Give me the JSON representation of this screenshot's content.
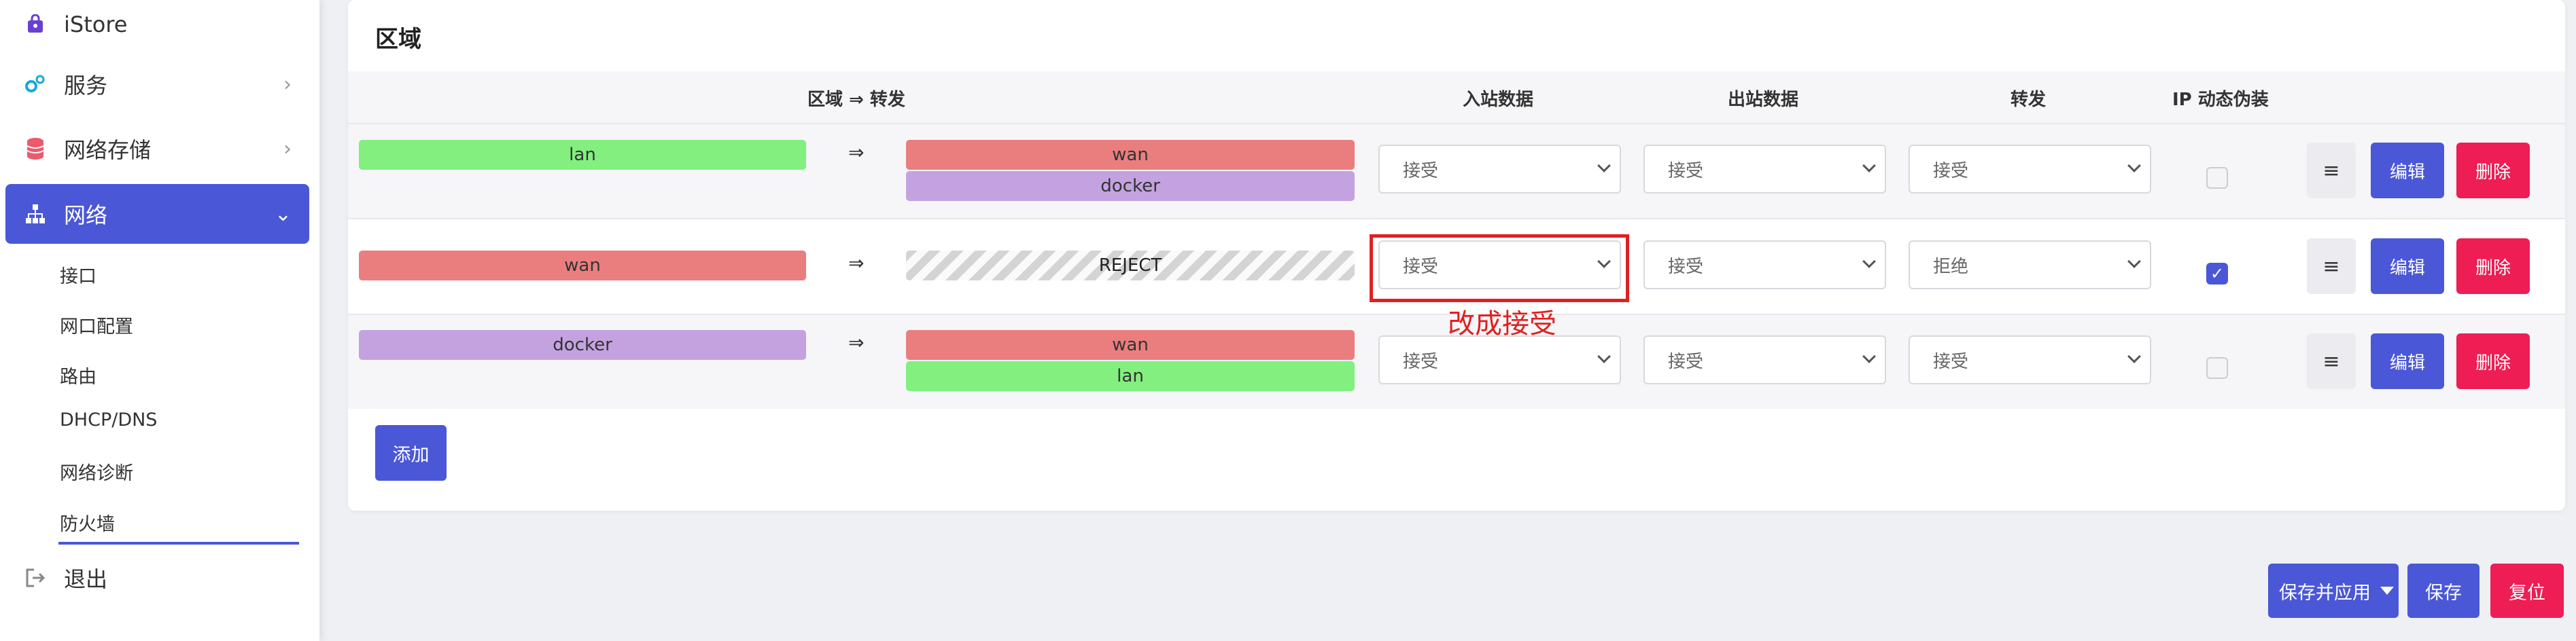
{
  "sidebar": {
    "items": [
      {
        "label": "iStore",
        "icon": "bag-icon"
      },
      {
        "label": "服务",
        "icon": "gears-icon"
      },
      {
        "label": "网络存储",
        "icon": "database-icon"
      },
      {
        "label": "网络",
        "icon": "network-icon"
      }
    ],
    "sub_items": [
      "接口",
      "网口配置",
      "路由",
      "DHCP/DNS",
      "网络诊断",
      "防火墙"
    ],
    "logout": "退出"
  },
  "zones": {
    "title": "区域",
    "headers": {
      "zone_forward": "区域 ⇒ 转发",
      "input": "入站数据",
      "output": "出站数据",
      "forward": "转发",
      "masq": "IP 动态伪装"
    },
    "rows": [
      {
        "zone": "lan",
        "forwards": [
          "wan",
          "docker"
        ],
        "input": "接受",
        "output": "接受",
        "forward": "接受",
        "masq": false
      },
      {
        "zone": "wan",
        "forwards": [
          "REJECT"
        ],
        "input": "接受",
        "output": "接受",
        "forward": "拒绝",
        "masq": true
      },
      {
        "zone": "docker",
        "forwards": [
          "wan",
          "lan"
        ],
        "input": "接受",
        "output": "接受",
        "forward": "接受",
        "masq": false
      }
    ],
    "arrow": "⇒",
    "menu_label": "≡",
    "edit_label": "编辑",
    "delete_label": "删除",
    "add_label": "添加",
    "annotation": "改成接受"
  },
  "footer": {
    "save_apply": "保存并应用",
    "save": "保存",
    "reset": "复位"
  },
  "colors": {
    "accent": "#4a57d6",
    "danger": "#ee1d54",
    "zone_lan": "#82ef7e",
    "zone_wan": "#ea7e7e",
    "zone_docker": "#c4a2e0",
    "annotation": "#e02020"
  }
}
